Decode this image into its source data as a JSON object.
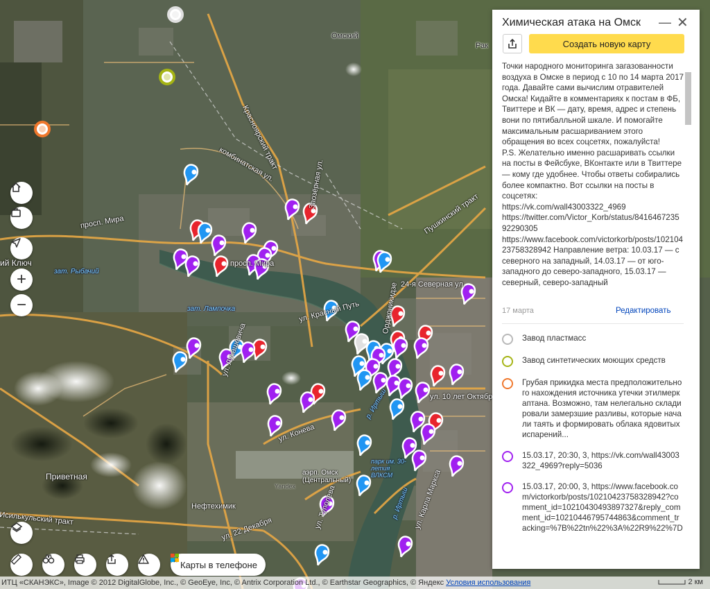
{
  "map": {
    "labels": [
      {
        "text": "Омский",
        "kind": "dark"
      },
      {
        "text": "Рак",
        "kind": "dark"
      },
      {
        "text": "Красноярский тракт",
        "kind": "light"
      },
      {
        "text": "комбинатская ул.",
        "kind": "light"
      },
      {
        "text": "Заозёрная ул.",
        "kind": "light"
      },
      {
        "text": "Пушкинский тракт",
        "kind": "light"
      },
      {
        "text": "просп. Мира",
        "kind": "light"
      },
      {
        "text": "просп. Мира",
        "kind": "light"
      },
      {
        "text": "ул. Красный Путь",
        "kind": "light"
      },
      {
        "text": "24-я Северная ул.",
        "kind": "light"
      },
      {
        "text": "Орджоникидзе",
        "kind": "light"
      },
      {
        "text": "ий Ключ",
        "kind": "light"
      },
      {
        "text": "зат. Рыбачий",
        "kind": "water"
      },
      {
        "text": "зат. Лампочка",
        "kind": "water"
      },
      {
        "text": "ул. Конева",
        "kind": "light"
      },
      {
        "text": "ул. 10 лет Октября",
        "kind": "light"
      },
      {
        "text": "р. Иртыш",
        "kind": "water"
      },
      {
        "text": "парк им. 30-летия ВЛКСМ",
        "kind": "water"
      },
      {
        "text": "аэрп. Омск (Центральный)",
        "kind": "light"
      },
      {
        "text": "Приветная",
        "kind": "light"
      },
      {
        "text": "Нефтехимик",
        "kind": "light"
      },
      {
        "text": "Исилькульский тракт",
        "kind": "light"
      },
      {
        "text": "ул. 22 Декабря",
        "kind": "light"
      },
      {
        "text": "р. Иртыш",
        "kind": "water"
      },
      {
        "text": "ул. Карла Маркса",
        "kind": "light"
      },
      {
        "text": "ул. Лукашевича",
        "kind": "light"
      },
      {
        "text": "ул. Туполева",
        "kind": "light"
      },
      {
        "text": "Yandex",
        "kind": "dark"
      }
    ],
    "controls": {
      "home": "home-icon",
      "briefcase": "briefcase-icon",
      "locate": "geolocation-icon",
      "zoom_in": "+",
      "zoom_out": "−",
      "layers": "layers-icon",
      "ruler": "ruler-icon",
      "binoculars": "panorama-icon",
      "print": "print-icon",
      "share": "share-icon",
      "alert": "alert-icon"
    },
    "phone_label": "Карты в телефоне",
    "copyright_text": "ИТЦ «СКАНЭКС», Image © 2012 DigitalGlobe, Inc., © GeoEye, Inc, © Antrix Corporation Ltd., © Earthstar Geographics, © Яндекс ",
    "terms_link": "Условия использования",
    "scale_label": "2 км",
    "colors": {
      "purple": "#a020f0",
      "red": "#e8242d",
      "blue": "#2196f3",
      "white": "#e0e0e0",
      "olive": "#a5b414",
      "orange": "#f0782d"
    }
  },
  "panel": {
    "title": "Химическая атака на Омск",
    "minimize": "—",
    "close": "✕",
    "create_button": "Создать новую карту",
    "description": [
      "Точки народного мониторинга загазованности воздуха в Омске в период с 10 по 14 марта 2017 года. Давайте сами вычислим отравителей Омска! Кидайте в комментариях к постам в ФБ, Твиттере и ВК — дату, время, адрес и степень вони по пятибалльной шкале. И помогайте максимальным расшариванием этого обращения во всех соцсетях, пожалуйста!",
      "P.S. Желательно именно расшаривать ссылки на посты в Фейсбуке, ВКонтакте или в Твиттере — кому где удобнее. Чтобы ответы собирались более компактно. Вот ссылки на посты в соцсетях:",
      "https://vk.com/wall43003322_4969",
      "https://twitter.com/Victor_Korb/status/841646723592290305",
      "https://www.facebook.com/victorkorb/posts/10210423758328942 Направление ветра: 10.03.17 — с северного на западный, 14.03.17 — от юго-западного до северо-западного, 15.03.17 — северный, северо-западный"
    ],
    "date": "17 марта",
    "edit": "Редактировать",
    "items": [
      {
        "text": "Завод пластмасс",
        "color": "#b8b8b8"
      },
      {
        "text": "Завод синтетических моющих средств",
        "color": "#a5b414"
      },
      {
        "text": "Грубая прикидка места предположительного нахождения источника утечки этилмеркаптана. Возможно, там нелегально складировали замерзшие разливы, которые начали таять и формировать облака ядовитых испарений...",
        "color": "#f0782d"
      },
      {
        "text": "15.03.17, 20:30, 3, https://vk.com/wall43003322_4969?reply=5036",
        "color": "#a020f0"
      },
      {
        "text": "15.03.17, 20:00, 3, https://www.facebook.com/victorkorb/posts/10210423758328942?comment_id=10210430493897327&reply_comment_id=10210446795744863&comment_tracking=%7B%22tn%22%3A%22R9%22%7D",
        "color": "#a020f0"
      }
    ]
  }
}
